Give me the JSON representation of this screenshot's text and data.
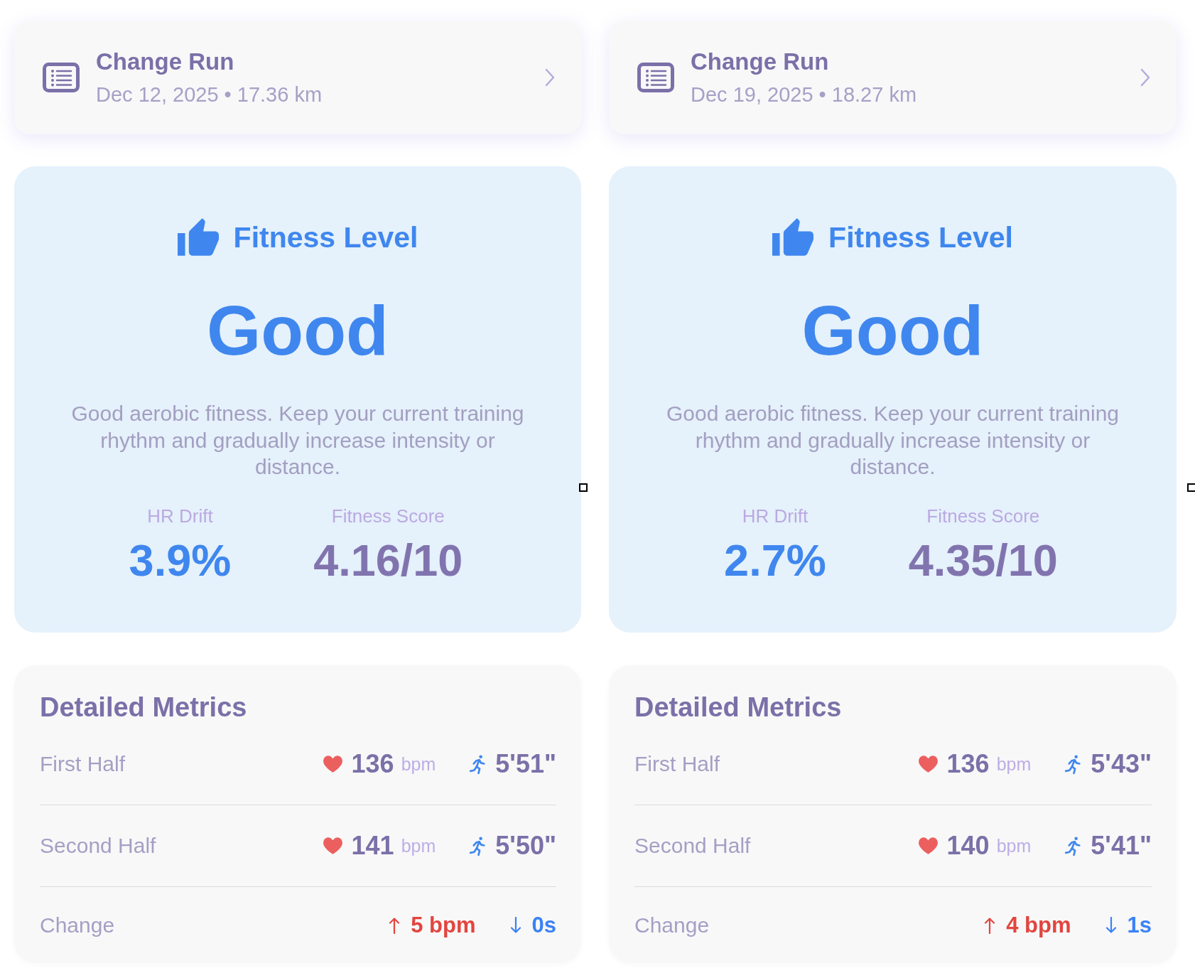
{
  "columns": [
    {
      "run_picker": {
        "title": "Change Run",
        "subtitle": "Dec 12, 2025 • 17.36 km"
      },
      "fitness": {
        "heading": "Fitness Level",
        "rating": "Good",
        "description": "Good aerobic fitness. Keep your current training rhythm and gradually increase intensity or distance.",
        "stats": [
          {
            "kind": "drift",
            "label": "HR Drift",
            "value": "3.9%"
          },
          {
            "kind": "score",
            "label": "Fitness Score",
            "value": "4.16/10"
          }
        ]
      },
      "metrics": {
        "title": "Detailed Metrics",
        "rows": [
          {
            "kind": "split",
            "label": "First Half",
            "heart_rate": "136",
            "unit": "bpm",
            "pace": "5'51\""
          },
          {
            "kind": "split",
            "label": "Second Half",
            "heart_rate": "141",
            "unit": "bpm",
            "pace": "5'50\""
          },
          {
            "kind": "change",
            "label": "Change",
            "heart_rate_change": "5 bpm",
            "heart_rate_rising": true,
            "pace_change": "0s",
            "pace_rising": false
          }
        ]
      }
    },
    {
      "run_picker": {
        "title": "Change Run",
        "subtitle": "Dec 19, 2025 • 18.27 km"
      },
      "fitness": {
        "heading": "Fitness Level",
        "rating": "Good",
        "description": "Good aerobic fitness. Keep your current training rhythm and gradually increase intensity or distance.",
        "stats": [
          {
            "kind": "drift",
            "label": "HR Drift",
            "value": "2.7%"
          },
          {
            "kind": "score",
            "label": "Fitness Score",
            "value": "4.35/10"
          }
        ]
      },
      "metrics": {
        "title": "Detailed Metrics",
        "rows": [
          {
            "kind": "split",
            "label": "First Half",
            "heart_rate": "136",
            "unit": "bpm",
            "pace": "5'43\""
          },
          {
            "kind": "split",
            "label": "Second Half",
            "heart_rate": "140",
            "unit": "bpm",
            "pace": "5'41\""
          },
          {
            "kind": "change",
            "label": "Change",
            "heart_rate_change": "4 bpm",
            "heart_rate_rising": true,
            "pace_change": "1s",
            "pace_rising": false
          }
        ]
      }
    }
  ]
}
